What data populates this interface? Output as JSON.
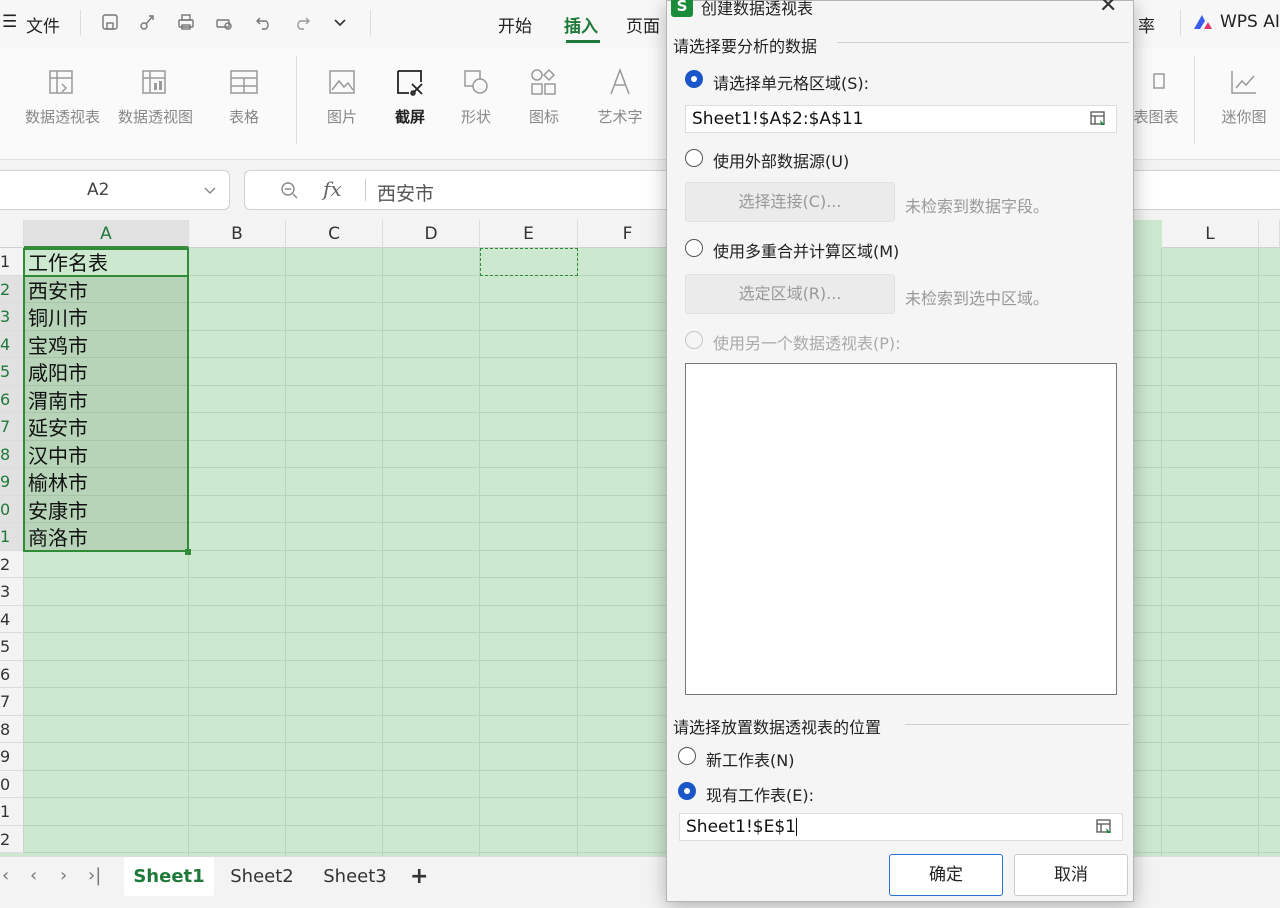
{
  "titlebar": {
    "file_menu": "文件",
    "tabs": [
      "开始",
      "插入",
      "页面"
    ],
    "active_tab": "插入",
    "right_partial": "率",
    "wps_ai": "WPS AI"
  },
  "ribbon": {
    "items": [
      "数据透视表",
      "数据透视图",
      "表格",
      "图片",
      "截屏",
      "形状",
      "图标",
      "艺术字"
    ],
    "right_items": [
      "表图表",
      "迷你图"
    ]
  },
  "formula": {
    "name_box": "A2",
    "content": "西安市"
  },
  "grid": {
    "columns": [
      "A",
      "B",
      "C",
      "D",
      "E",
      "F",
      "L"
    ],
    "rows": [
      "1",
      "2",
      "3",
      "4",
      "5",
      "6",
      "7",
      "8",
      "9",
      "0",
      "1",
      "2",
      "3",
      "4",
      "5",
      "6",
      "7",
      "8",
      "9",
      "0",
      "1",
      "2"
    ],
    "cells": [
      "工作名表",
      "西安市",
      "铜川市",
      "宝鸡市",
      "咸阳市",
      "渭南市",
      "延安市",
      "汉中市",
      "榆林市",
      "安康市",
      "商洛市"
    ]
  },
  "sheets": {
    "tabs": [
      "Sheet1",
      "Sheet2",
      "Sheet3"
    ],
    "active": "Sheet1",
    "add": "+"
  },
  "dialog": {
    "title": "创建数据透视表",
    "close": "✕",
    "section1": "请选择要分析的数据",
    "opt_range": "请选择单元格区域(S):",
    "range_value": "Sheet1!$A$2:$A$11",
    "opt_external": "使用外部数据源(U)",
    "btn_connect": "选择连接(C)...",
    "hint_connect": "未检索到数据字段。",
    "opt_multi": "使用多重合并计算区域(M)",
    "btn_select": "选定区域(R)...",
    "hint_select": "未检索到选中区域。",
    "opt_other_pivot": "使用另一个数据透视表(P):",
    "section2": "请选择放置数据透视表的位置",
    "opt_new_sheet": "新工作表(N)",
    "opt_existing": "现有工作表(E):",
    "existing_value": "Sheet1!$E$1",
    "ok": "确定",
    "cancel": "取消"
  },
  "colors": {
    "accent": "#1f7a3a",
    "radio": "#1a56c8",
    "grid_bg": "#cce8cf"
  }
}
